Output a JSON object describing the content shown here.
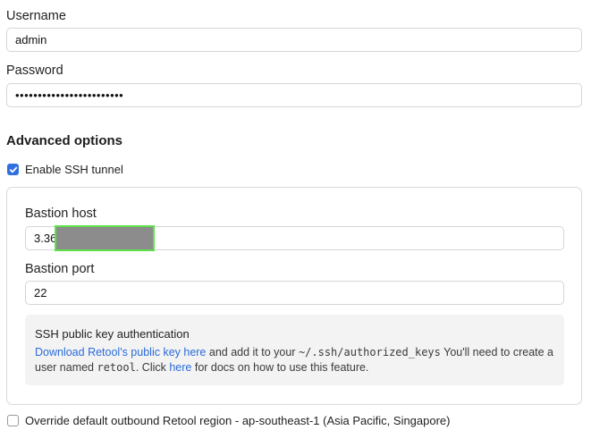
{
  "username": {
    "label": "Username",
    "value": "admin"
  },
  "password": {
    "label": "Password",
    "value": "••••••••••••••••••••••••"
  },
  "advanced": {
    "title": "Advanced options",
    "ssh_checkbox_label": "Enable SSH tunnel",
    "ssh_checked": true
  },
  "bastion": {
    "host_label": "Bastion host",
    "host_value": "3.36",
    "port_label": "Bastion port",
    "port_value": "22"
  },
  "ssh_info": {
    "title": "SSH public key authentication",
    "download_link": "Download Retool's public key here",
    "text_1": " and add it to your ",
    "path": "~/.ssh/authorized_keys",
    "text_2": " You'll need to create a",
    "text_3": "user named ",
    "user": "retool",
    "text_4": ". Click ",
    "here_link": "here",
    "text_5": " for docs on how to use this feature."
  },
  "region": {
    "checkbox_label": "Override default outbound Retool region - ap-southeast-1 (Asia Pacific, Singapore)",
    "checked": false
  },
  "colors": {
    "accent": "#2f6fe0",
    "link": "#2a6bd8",
    "redaction_fill": "#8c8c8c",
    "redaction_border": "#5fe04a"
  }
}
